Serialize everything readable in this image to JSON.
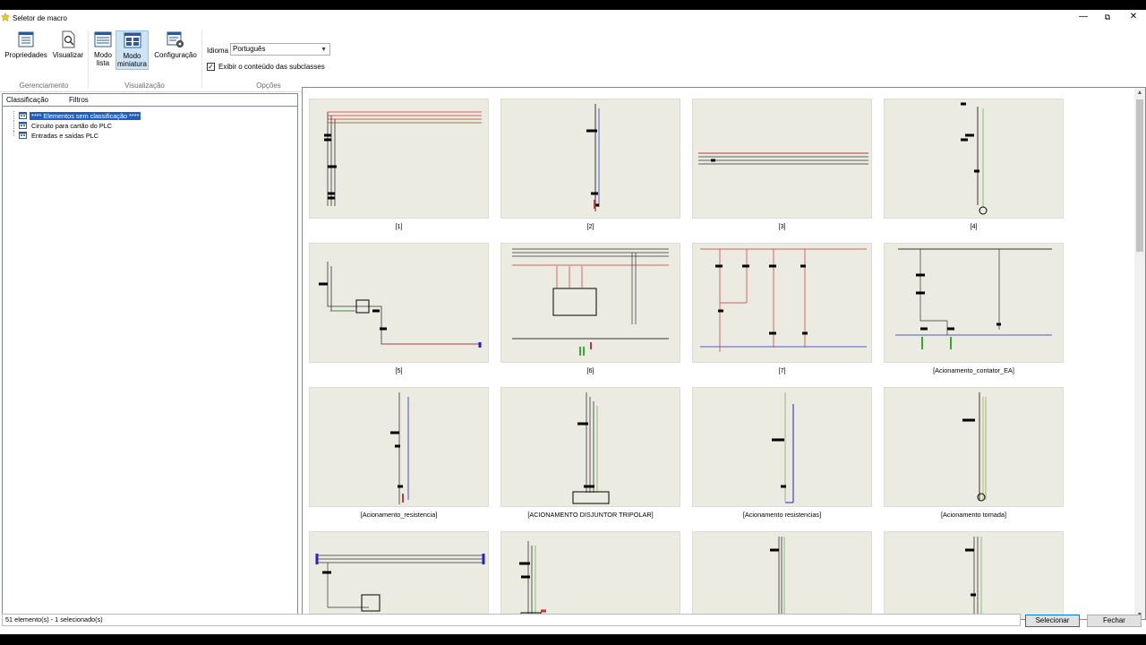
{
  "window": {
    "title": "Seletor de macro"
  },
  "ribbon": {
    "buttons": [
      {
        "label": "Propriedades",
        "icon": "properties-icon"
      },
      {
        "label": "Visualizar",
        "icon": "preview-icon"
      },
      {
        "label": "Modo\nlista",
        "icon": "list-mode-icon"
      },
      {
        "label": "Modo\nminiatura",
        "icon": "thumbnail-mode-icon"
      },
      {
        "label": "Configuração",
        "icon": "settings-icon"
      }
    ],
    "groups": [
      "Gerenciamento",
      "Visualização",
      "Opções"
    ],
    "language_label": "Idioma",
    "language_value": "Português",
    "subclasses_checkbox": "Exibir o conteúdo das subclasses",
    "subclasses_checked": true
  },
  "left": {
    "tabs": [
      "Classificação",
      "Filtros"
    ],
    "tree": [
      "**** Elementos sem classificação ****",
      "Circuito para cartão do PLC",
      "Entradas e saídas PLC"
    ]
  },
  "thumbnails": [
    "[1]",
    "[2]",
    "[3]",
    "[4]",
    "[5]",
    "[6]",
    "[7]",
    "[Acionamento_contator_EA]",
    "[Acionamento_resistencia]",
    "[ACIONAMENTO DISJUNTOR TRIPOLAR]",
    "[Acionamento resistencias]",
    "[Acionamento tomada]",
    "",
    "",
    "",
    ""
  ],
  "status": {
    "text": "51 elemento(s) - 1 selecionado(s)"
  },
  "buttons": {
    "select": "Selecionar",
    "close": "Fechar"
  }
}
